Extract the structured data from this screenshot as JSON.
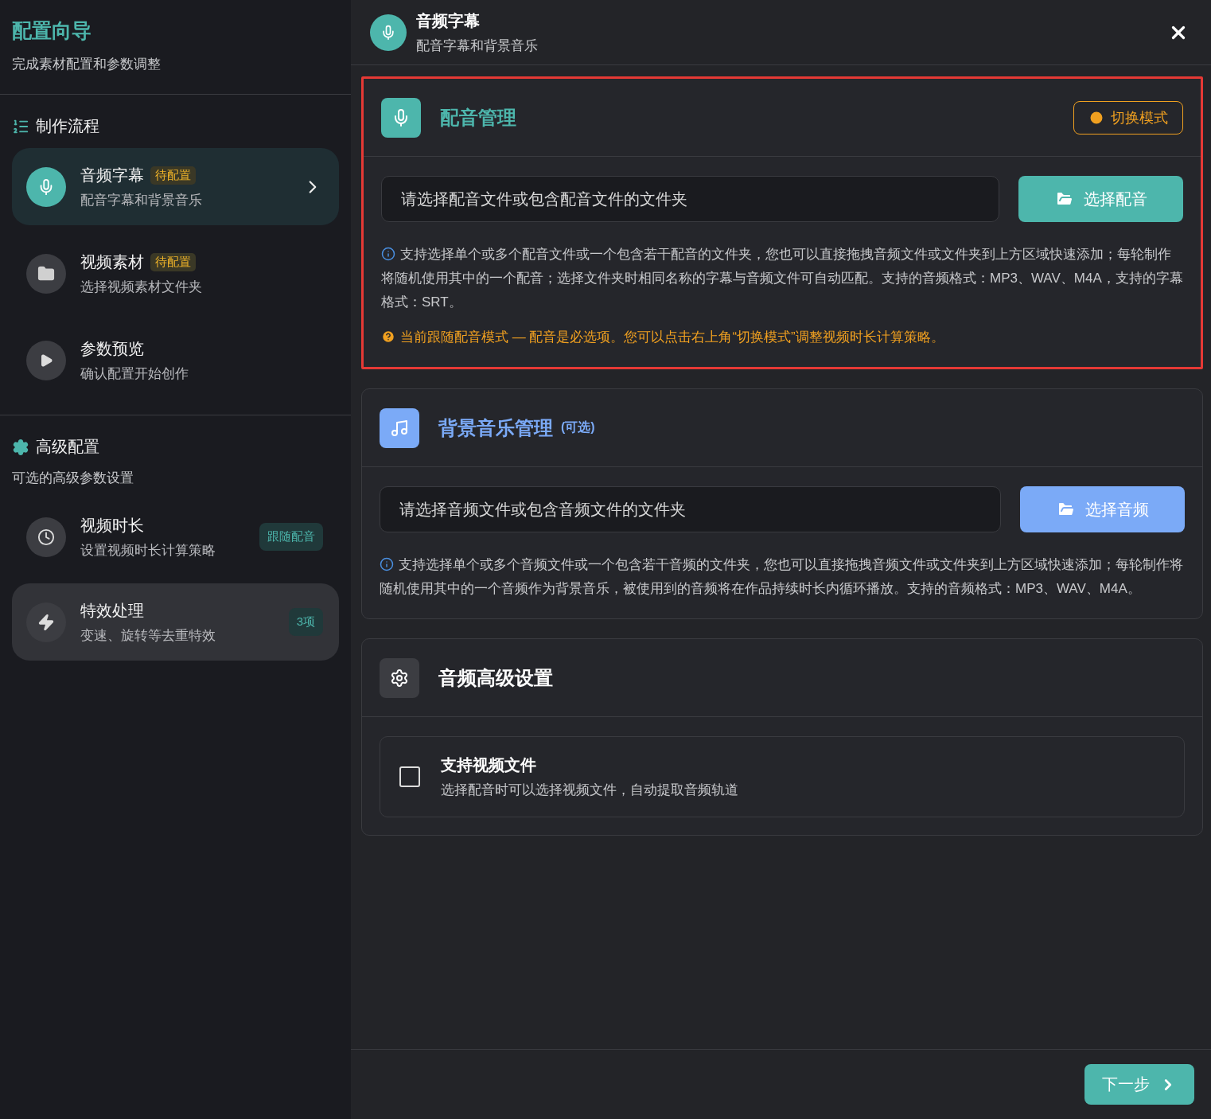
{
  "sidebar": {
    "title": "配置向导",
    "subtitle": "完成素材配置和参数调整",
    "workflow": {
      "title": "制作流程",
      "items": [
        {
          "title": "音频字幕",
          "badge": "待配置",
          "description": "配音字幕和背景音乐",
          "selected": true
        },
        {
          "title": "视频素材",
          "badge": "待配置",
          "description": "选择视频素材文件夹",
          "selected": false
        },
        {
          "title": "参数预览",
          "description": "确认配置开始创作",
          "selected": false
        }
      ]
    },
    "advanced": {
      "title": "高级配置",
      "subtitle": "可选的高级参数设置",
      "items": [
        {
          "title": "视频时长",
          "description": "设置视频时长计算策略",
          "tag": "跟随配音",
          "hovered": false
        },
        {
          "title": "特效处理",
          "description": "变速、旋转等去重特效",
          "tag": "3项",
          "hovered": true
        }
      ]
    }
  },
  "header": {
    "title": "音频字幕",
    "subtitle": "配音字幕和背景音乐"
  },
  "sections": [
    {
      "kind": "file",
      "title": "配音管理",
      "highlighted": true,
      "action": "切换模式",
      "placeholder": "请选择配音文件或包含配音文件的文件夹",
      "button": "选择配音",
      "info": "支持选择单个或多个配音文件或一个包含若干配音的文件夹，您也可以直接拖拽音频文件或文件夹到上方区域快速添加；每轮制作将随机使用其中的一个配音；选择文件夹时相同名称的字幕与音频文件可自动匹配。支持的音频格式：MP3、WAV、M4A，支持的字幕格式：SRT。",
      "warning": "当前跟随配音模式 — 配音是必选项。您可以点击右上角“切换模式”调整视频时长计算策略。"
    },
    {
      "kind": "file",
      "title": "背景音乐管理",
      "optional": "(可选)",
      "highlighted": false,
      "placeholder": "请选择音频文件或包含音频文件的文件夹",
      "button": "选择音频",
      "info": "支持选择单个或多个音频文件或一个包含若干音频的文件夹，您也可以直接拖拽音频文件或文件夹到上方区域快速添加；每轮制作将随机使用其中的一个音频作为背景音乐，被使用到的音频将在作品持续时长内循环播放。支持的音频格式：MP3、WAV、M4A。"
    },
    {
      "kind": "options",
      "title": "音频高级设置",
      "highlighted": false,
      "options": [
        {
          "label": "支持视频文件",
          "description": "选择配音时可以选择视频文件，自动提取音频轨道",
          "checked": false
        }
      ]
    }
  ],
  "footer": {
    "next": "下一步"
  }
}
